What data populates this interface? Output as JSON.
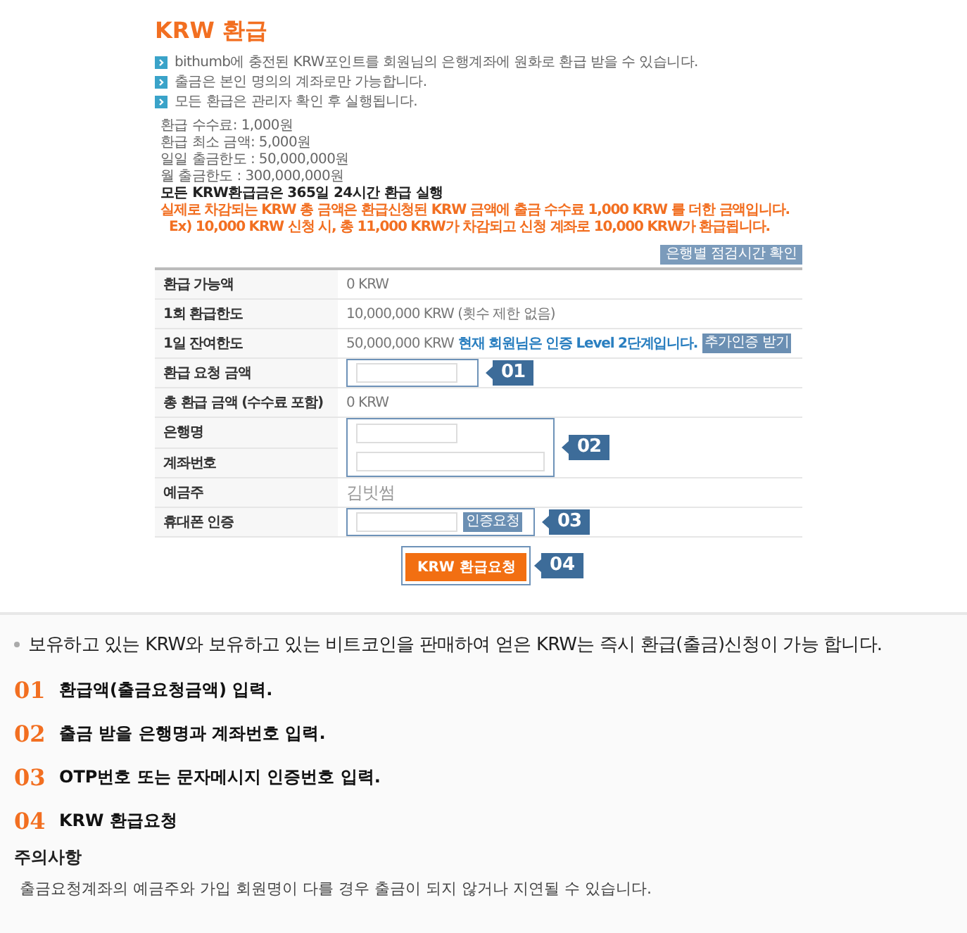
{
  "title": "KRW 환급",
  "notices": [
    "bithumb에 충전된 KRW포인트를 회원님의 은행계좌에 원화로 환급 받을 수 있습니다.",
    "출금은 본인 명의의 계좌로만 가능합니다.",
    "모든 환급은 관리자 확인 후 실행됩니다."
  ],
  "rules": [
    {
      "kind": "plain",
      "text": "환급 수수료: 1,000원"
    },
    {
      "kind": "plain",
      "text": "환급 최소 금액: 5,000원"
    },
    {
      "kind": "plain",
      "text": "일일 출금한도 : 50,000,000원"
    },
    {
      "kind": "plain",
      "text": "월 출금한도 : 300,000,000원"
    },
    {
      "kind": "bold",
      "text": "모든 KRW환급금은 365일 24시간 환급 실행"
    },
    {
      "kind": "warning",
      "text": "실제로 차감되는 KRW 총 금액은 환급신청된 KRW 금액에 출금 수수료 1,000 KRW 를 더한 금액입니다."
    },
    {
      "kind": "example",
      "text": "Ex) 10,000 KRW 신청 시, 총 11,000 KRW가 차감되고 신청 계좌로 10,000 KRW가 환급됩니다."
    }
  ],
  "schedule_button": "은행별 점검시간 확인",
  "form_rows": [
    {
      "kind": "text",
      "labels": [
        "환급 가능액"
      ],
      "value": "0 KRW"
    },
    {
      "kind": "text",
      "labels": [
        "1회 환급한도"
      ],
      "value": "10,000,000 KRW (횟수 제한 없음)"
    },
    {
      "kind": "text",
      "labels": [
        "1일 잔여한도"
      ],
      "value": "50,000,000 KRW",
      "link": "현재 회원님은 인증 Level 2단계입니다.",
      "button": "추가인증 받기"
    },
    {
      "kind": "input",
      "labels": [
        "환급 요청 금액"
      ],
      "callout": "01"
    },
    {
      "kind": "text",
      "labels": [
        "총 환급 금액 (수수료 포함)"
      ],
      "value": "0 KRW"
    },
    {
      "kind": "input-pair",
      "labels": [
        "은행명",
        "계좌번호"
      ],
      "callout": "02"
    },
    {
      "kind": "name",
      "labels": [
        "예금주"
      ],
      "value": "김빗썸"
    },
    {
      "kind": "input-button",
      "labels": [
        "휴대폰 인증"
      ],
      "button": "인증요청",
      "callout": "03"
    }
  ],
  "submit": {
    "label": "KRW 환급요청",
    "callout": "04"
  },
  "intro": "보유하고 있는 KRW와 보유하고 있는 비트코인을 판매하여 얻은 KRW는 즉시 환급(출금)신청이 가능 합니다.",
  "steps": [
    {
      "number": "01",
      "text": "환급액(출금요청금액) 입력."
    },
    {
      "number": "02",
      "text": "출금 받을 은행명과 계좌번호 입력."
    },
    {
      "number": "03",
      "text": "OTP번호 또는 문자메시지 인증번호 입력."
    },
    {
      "number": "04",
      "text": "KRW 환급요청"
    }
  ],
  "caution": {
    "title": "주의사항",
    "text": "출금요청계좌의 예금주와 가입 회원명이 다를 경우 출금이 되지 않거나 지연될 수 있습니다."
  }
}
